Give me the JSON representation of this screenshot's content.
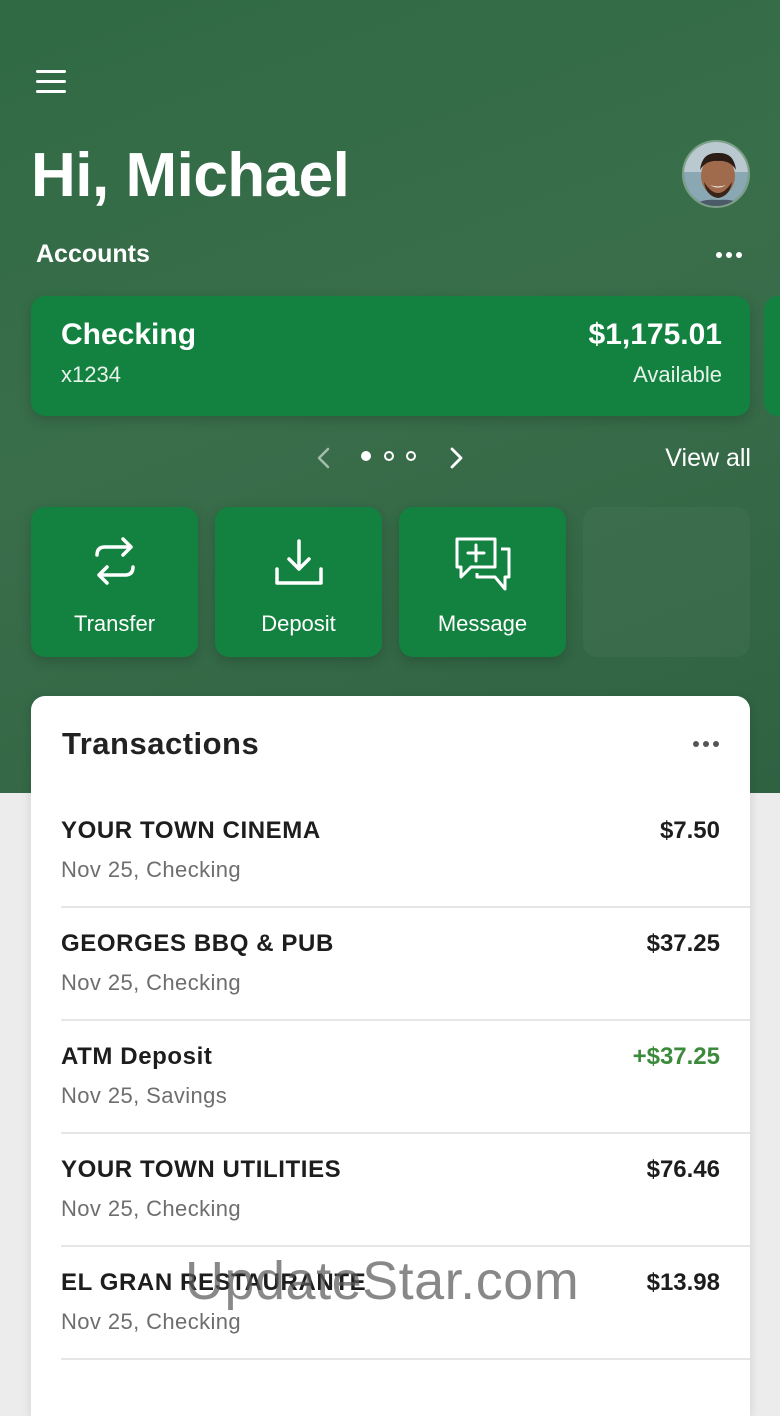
{
  "header": {
    "greeting": "Hi, Michael"
  },
  "accounts": {
    "label": "Accounts",
    "cards": [
      {
        "name": "Checking",
        "number": "x1234",
        "balance": "$1,175.01",
        "balance_label": "Available"
      }
    ],
    "pager": {
      "total": 3,
      "active": 1
    },
    "view_all": "View all"
  },
  "actions": [
    {
      "label": "Transfer",
      "icon": "transfer-icon"
    },
    {
      "label": "Deposit",
      "icon": "deposit-icon"
    },
    {
      "label": "Message",
      "icon": "message-icon"
    }
  ],
  "transactions": {
    "title": "Transactions",
    "items": [
      {
        "merchant": "YOUR TOWN CINEMA",
        "meta": "Nov 25, Checking",
        "amount": "$7.50",
        "credit": false
      },
      {
        "merchant": "GEORGES BBQ & PUB",
        "meta": "Nov 25, Checking",
        "amount": "$37.25",
        "credit": false
      },
      {
        "merchant": "ATM Deposit",
        "meta": "Nov 25, Savings",
        "amount": "+$37.25",
        "credit": true
      },
      {
        "merchant": "YOUR TOWN UTILITIES",
        "meta": "Nov 25, Checking",
        "amount": "$76.46",
        "credit": false
      },
      {
        "merchant": "EL GRAN RESTAURANTE",
        "meta": "Nov 25, Checking",
        "amount": "$13.98",
        "credit": false
      }
    ]
  },
  "watermark": "UpdateStar.com",
  "colors": {
    "brand_green": "#138241",
    "hero_green": "#3a6e4b",
    "credit_green": "#3c8a3c"
  }
}
